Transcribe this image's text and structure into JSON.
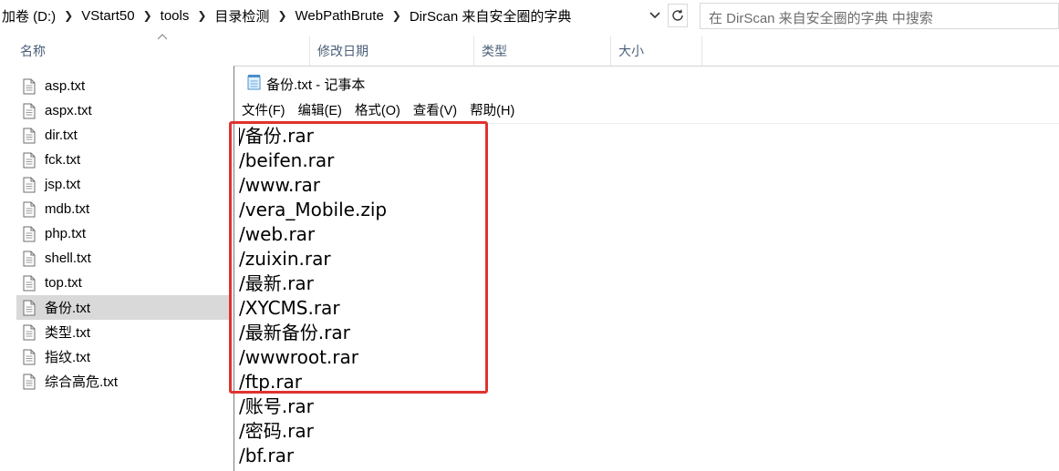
{
  "explorer": {
    "breadcrumb": [
      "加卷 (D:)",
      "VStart50",
      "tools",
      "目录检测",
      "WebPathBrute",
      "DirScan 来自安全圈的字典"
    ],
    "search_placeholder": "在 DirScan 来自安全圈的字典 中搜索",
    "columns": {
      "name": "名称",
      "modified": "修改日期",
      "type": "类型",
      "size": "大小"
    },
    "files": [
      "asp.txt",
      "aspx.txt",
      "dir.txt",
      "fck.txt",
      "jsp.txt",
      "mdb.txt",
      "php.txt",
      "shell.txt",
      "top.txt",
      "备份.txt",
      "类型.txt",
      "指纹.txt",
      "综合高危.txt"
    ],
    "selected_file": "备份.txt"
  },
  "notepad": {
    "title": "备份.txt - 记事本",
    "menu": [
      "文件(F)",
      "编辑(E)",
      "格式(O)",
      "查看(V)",
      "帮助(H)"
    ],
    "lines": [
      "/备份.rar",
      "/beifen.rar",
      "/www.rar",
      "/vera_Mobile.zip",
      "/web.rar",
      "/zuixin.rar",
      "/最新.rar",
      "/XYCMS.rar",
      "/最新备份.rar",
      "/wwwroot.rar",
      "/ftp.rar",
      "/账号.rar",
      "/密码.rar",
      "/bf.rar"
    ]
  },
  "annotation": {
    "highlight_color": "#e0322e"
  },
  "icons": {
    "file": "text-file-icon",
    "notepad": "notepad-icon",
    "dropdown": "chevron-down-icon",
    "refresh": "refresh-icon",
    "sort": "sort-up-icon"
  }
}
